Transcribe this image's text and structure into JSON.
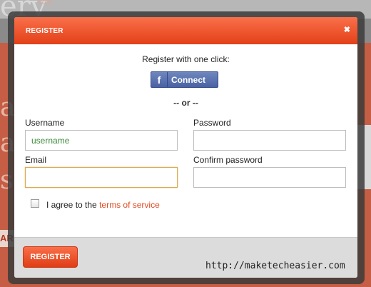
{
  "background": {
    "logo_text": "ery",
    "logo_small": "com",
    "bar_text": "AR"
  },
  "modal": {
    "title": "REGISTER",
    "close_icon": "close-icon",
    "close_glyph": "✖"
  },
  "intro_text": "Register with one click:",
  "facebook": {
    "icon_glyph": "f",
    "label": "Connect"
  },
  "or_text": "-- or --",
  "fields": {
    "username": {
      "label": "Username",
      "value": "",
      "placeholder": "username"
    },
    "password": {
      "label": "Password",
      "value": "",
      "placeholder": ""
    },
    "email": {
      "label": "Email",
      "value": "",
      "placeholder": ""
    },
    "confirm_password": {
      "label": "Confirm password",
      "value": "",
      "placeholder": ""
    }
  },
  "agree": {
    "prefix": "I agree to the ",
    "link": "terms of service",
    "checked": false
  },
  "footer": {
    "register_button": "REGISTER",
    "watermark": "http://maketecheasier.com"
  },
  "colors": {
    "accent": "#e8471f",
    "link": "#e04a22",
    "facebook": "#4a62a3"
  }
}
